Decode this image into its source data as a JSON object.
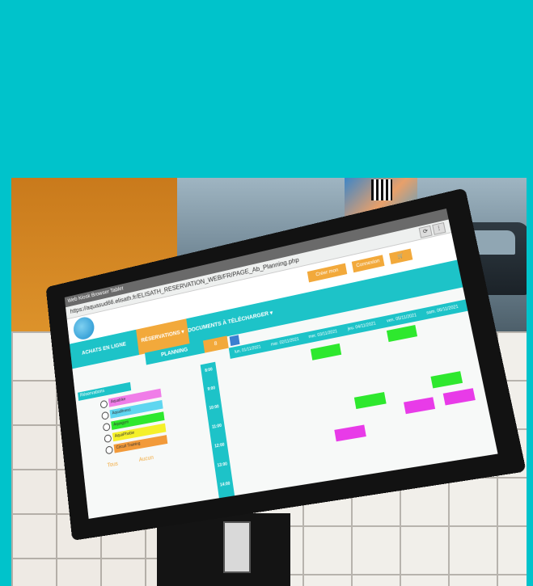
{
  "colors": {
    "background": "#00c3cb",
    "brand_teal": "#1dc3c8",
    "accent_orange": "#f2a93b",
    "event_green": "#2ee82e",
    "event_magenta": "#e83be8"
  },
  "kiosk": {
    "window_title": "Web Kiosk Browser Tablet",
    "address": "https://aquasud66.elisath.fr/ELISATH_RESERVATION_WEB/FR/PAGE_Ab_Planning.php",
    "header_buttons": [
      "Créer mon compte",
      "Connexion"
    ],
    "nav": {
      "items": [
        {
          "label": "ACHATS EN LIGNE"
        },
        {
          "label": "RÉSERVATIONS ▾"
        },
        {
          "label": "DOCUMENTS À TÉLÉCHARGER ▾"
        }
      ]
    },
    "sub_nav": "PLANNING",
    "page_number": "8",
    "days": [
      "lun. 01/11/2021",
      "mar. 02/11/2021",
      "mer. 03/11/2021",
      "jeu. 04/11/2021",
      "ven. 05/11/2021",
      "sam. 06/11/2021"
    ],
    "legend": {
      "title": "Réservations",
      "items": [
        "Aquabike",
        "Aquafitness",
        "Aquagym",
        "AquaPhobie",
        "Circuit Training"
      ],
      "links": [
        "Tous",
        "Aucun"
      ]
    },
    "times": [
      "8:00",
      "9:00",
      "10:00",
      "11:00",
      "12:00",
      "13:00",
      "14:00"
    ]
  }
}
